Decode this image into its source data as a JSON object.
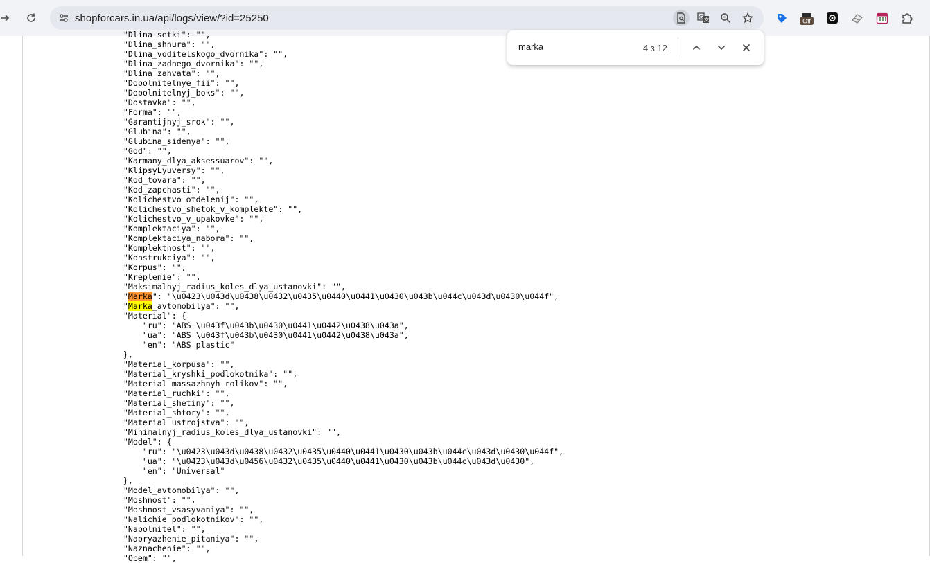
{
  "browser": {
    "url": "shopforcars.in.ua/api/logs/view/?id=25250",
    "extension_badge": "Off"
  },
  "find_bar": {
    "query": "marka",
    "match_count": "4 з 12"
  },
  "code_lines": [
    "    \"Dlina_setki\": \"\",",
    "    \"Dlina_shnura\": \"\",",
    "    \"Dlina_voditelskogo_dvornika\": \"\",",
    "    \"Dlina_zadnego_dvornika\": \"\",",
    "    \"Dlina_zahvata\": \"\",",
    "    \"Dopolnitelnye_fii\": \"\",",
    "    \"Dopolnitelnyj_boks\": \"\",",
    "    \"Dostavka\": \"\",",
    "    \"Forma\": \"\",",
    "    \"Garantijnyj_srok\": \"\",",
    "    \"Glubina\": \"\",",
    "    \"Glubina_sidenya\": \"\",",
    "    \"God\": \"\",",
    "    \"Karmany_dlya_aksessuarov\": \"\",",
    "    \"KlipsyLyuversy\": \"\",",
    "    \"Kod_tovara\": \"\",",
    "    \"Kod_zapchasti\": \"\",",
    "    \"Kolichestvo_otdelenij\": \"\",",
    "    \"Kolichestvo_shetok_v_komplekte\": \"\",",
    "    \"Kolichestvo_v_upakovke\": \"\",",
    "    \"Komplektaciya\": \"\",",
    "    \"Komplektaciya_nabora\": \"\",",
    "    \"Komplektnost\": \"\",",
    "    \"Konstrukciya\": \"\",",
    "    \"Korpus\": \"\",",
    "    \"Kreplenie\": \"\",",
    "    \"Maksimalnyj_radius_koles_dlya_ustanovki\": \"\",",
    "    \"Marka\": \"\\u0423\\u043d\\u0438\\u0432\\u0435\\u0440\\u0441\\u0430\\u043b\\u044c\\u043d\\u0430\\u044f\",",
    "    \"Marka_avtomobilya\": \"\",",
    "    \"Material\": {",
    "        \"ru\": \"ABS \\u043f\\u043b\\u0430\\u0441\\u0442\\u0438\\u043a\",",
    "        \"ua\": \"ABS \\u043f\\u043b\\u0430\\u0441\\u0442\\u0438\\u043a\",",
    "        \"en\": \"ABS plastic\"",
    "    },",
    "    \"Material_korpusa\": \"\",",
    "    \"Material_kryshki_podlokotnika\": \"\",",
    "    \"Material_massazhnyh_rolikov\": \"\",",
    "    \"Material_ruchki\": \"\",",
    "    \"Material_shetiny\": \"\",",
    "    \"Material_shtory\": \"\",",
    "    \"Material_ustrojstva\": \"\",",
    "    \"Minimalnyj_radius_koles_dlya_ustanovki\": \"\",",
    "    \"Model\": {",
    "        \"ru\": \"\\u0423\\u043d\\u0438\\u0432\\u0435\\u0440\\u0441\\u0430\\u043b\\u044c\\u043d\\u0430\\u044f\",",
    "        \"ua\": \"\\u0423\\u043d\\u0456\\u0432\\u0435\\u0440\\u0441\\u0430\\u043b\\u044c\\u043d\\u0430\",",
    "        \"en\": \"Universal\"",
    "    },",
    "    \"Model_avtomobilya\": \"\",",
    "    \"Moshnost\": \"\",",
    "    \"Moshnost_vsasyvaniya\": \"\",",
    "    \"Nalichie_podlokotnikov\": \"\",",
    "    \"Napolnitel\": \"\",",
    "    \"Napryazhenie_pitaniya\": \"\",",
    "    \"Naznachenie\": \"\",",
    "    \"Obem\": \"\","
  ],
  "colors": {
    "toolbar_bg": "#f1f3f7",
    "omnibox_bg": "#e5e8ee",
    "match_highlight": "#ffff00",
    "current_match_highlight": "#ff9632"
  }
}
